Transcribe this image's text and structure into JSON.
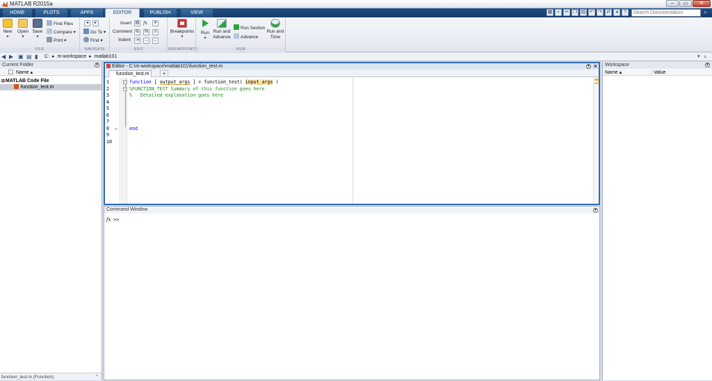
{
  "window": {
    "title": "MATLAB R2015a"
  },
  "tabs": [
    "HOME",
    "PLOTS",
    "APPS",
    "EDITOR",
    "PUBLISH",
    "VIEW"
  ],
  "active_tab": "EDITOR",
  "search": {
    "placeholder": "Search Documentation"
  },
  "ribbon": {
    "file": {
      "new": "New",
      "open": "Open",
      "save": "Save",
      "find_files": "Find Files",
      "compare": "Compare",
      "print": "Print",
      "group": "FILE"
    },
    "navigate": {
      "go_to": "Go To",
      "find": "Find",
      "group": "NAVIGATE"
    },
    "edit": {
      "insert": "Insert",
      "comment": "Comment",
      "indent": "Indent",
      "fx": "fx",
      "group": "EDIT"
    },
    "breakpoints": {
      "breakpoints": "Breakpoints",
      "group": "BREAKPOINTS"
    },
    "run": {
      "run": "Run",
      "run_advance_1": "Run and",
      "run_advance_2": "Advance",
      "run_section": "Run Section",
      "advance": "Advance",
      "run_time_1": "Run and",
      "run_time_2": "Time",
      "group": "RUN"
    }
  },
  "address": {
    "crumbs": [
      "C:",
      "▸",
      "m-workspace",
      "▸",
      "matlab101"
    ]
  },
  "current_folder": {
    "title": "Current Folder",
    "col_name": "Name ▴",
    "group": "MATLAB Code File",
    "file": "function_test.m",
    "status": "function_test.m (Function)"
  },
  "editor": {
    "title": "Editor - C:\\m-workspace\\matlab101\\function_test.m",
    "tab": "function_test.m",
    "add_tab": "+",
    "line_numbers": [
      "1",
      "2",
      "3",
      "4",
      "5",
      "6",
      "7",
      "8",
      "9",
      "10"
    ],
    "line1": {
      "kw": "function",
      "a": " [ ",
      "out": "output_args",
      "b": " ] = function_test( ",
      "in": "input_args",
      "c": " )"
    },
    "line2": "%FUNCTION_TEST Summary of this function goes here",
    "line3": "%   Detailed explanation goes here",
    "line8": "end",
    "breakpoint_dash": "–"
  },
  "command_window": {
    "title": "Command Window",
    "fx": "fx",
    "prompt": ">>"
  },
  "workspace": {
    "title": "Workspace",
    "col_name": "Name ▴",
    "col_value": "Value"
  },
  "colors": {
    "accent": "#2e6db5",
    "keyword": "#0000ff",
    "comment": "#228b22",
    "tabbar": "#1f4f86"
  }
}
